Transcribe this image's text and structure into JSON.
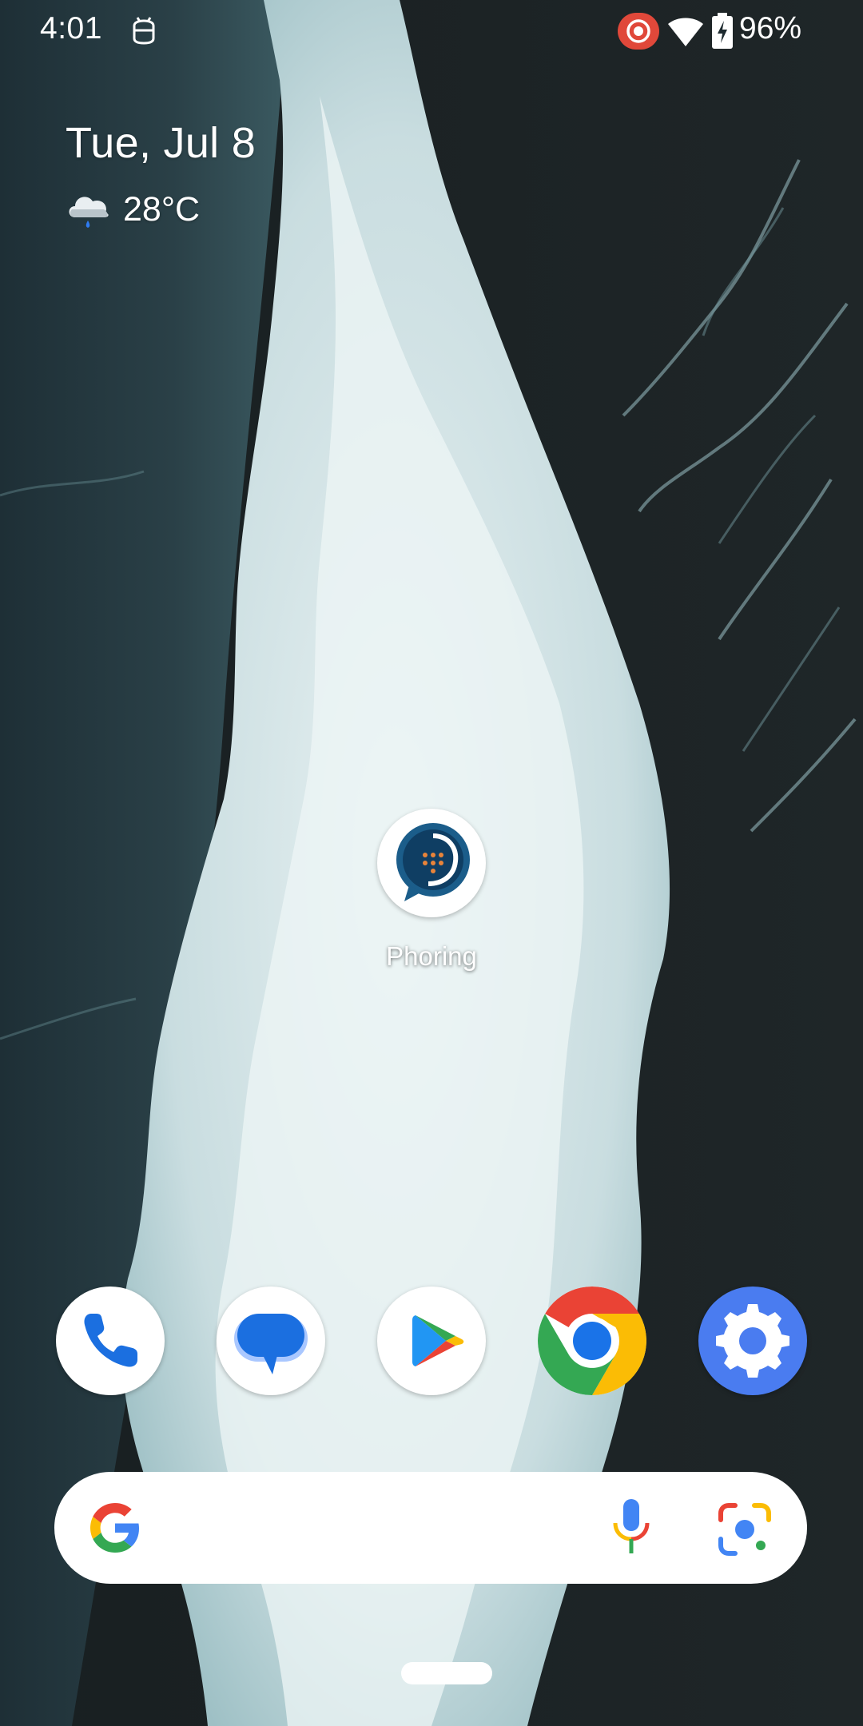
{
  "status_bar": {
    "time": "4:01",
    "battery": "96%",
    "icons": [
      "android-robot-icon",
      "screen-record-icon",
      "wifi-icon",
      "battery-charging-icon"
    ]
  },
  "glance": {
    "date": "Tue, Jul 8",
    "temperature": "28°C",
    "weather_icon": "cloud-rain-icon"
  },
  "home_apps": [
    {
      "label": "Phoring",
      "icon": "phoring-app-icon"
    }
  ],
  "dock": [
    {
      "app": "Phone",
      "icon": "phone-icon"
    },
    {
      "app": "Messages",
      "icon": "messages-icon"
    },
    {
      "app": "Play Store",
      "icon": "play-store-icon"
    },
    {
      "app": "Chrome",
      "icon": "chrome-icon"
    },
    {
      "app": "Settings",
      "icon": "settings-gear-icon"
    }
  ],
  "search": {
    "icons": [
      "google-g-icon",
      "microphone-icon",
      "google-lens-icon"
    ]
  },
  "colors": {
    "google_blue": "#4285F4",
    "google_red": "#EA4335",
    "google_yellow": "#FBBC05",
    "google_green": "#34A853",
    "record_red": "#E0483A",
    "settings_blue": "#4A7CF0"
  }
}
